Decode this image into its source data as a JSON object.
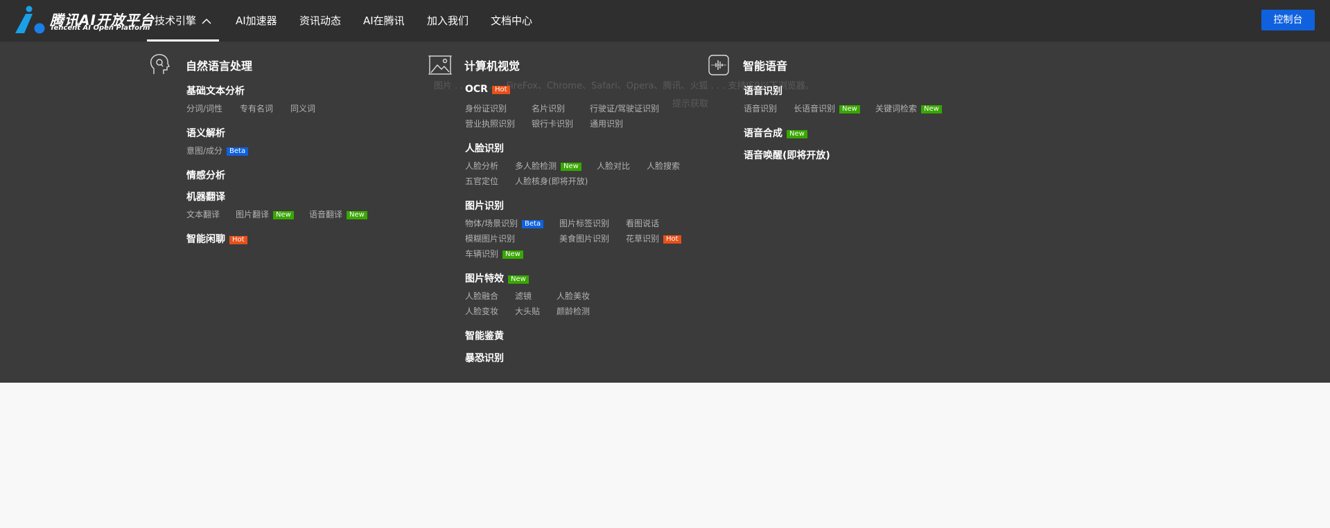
{
  "brand": {
    "name_cn": "腾讯AI开放平台",
    "name_en": "Tencent AI Open Platform"
  },
  "nav": {
    "items": [
      {
        "label": "技术引擎",
        "active": true
      },
      {
        "label": "AI加速器"
      },
      {
        "label": "资讯动态"
      },
      {
        "label": "AI在腾讯"
      },
      {
        "label": "加入我们"
      },
      {
        "label": "文档中心"
      }
    ],
    "console_label": "控制台"
  },
  "background_text": {
    "line1": "图片 . . . . . . . . . FireFox、Chrome、Safari、Opera、腾讯、火狐 . . . 支持IE9以下浏览器。",
    "line2": "提示获取"
  },
  "badges": {
    "hot": "Hot",
    "new": "New",
    "beta": "Beta"
  },
  "columns": {
    "nlp": {
      "title": "自然语言处理",
      "sections": {
        "basic": {
          "title": "基础文本分析",
          "links": [
            "分词/词性",
            "专有名词",
            "同义词"
          ]
        },
        "semantic": {
          "title": "语义解析",
          "links": [
            "意图/成分"
          ]
        },
        "sentiment": {
          "title": "情感分析"
        },
        "translate": {
          "title": "机器翻译",
          "links": [
            "文本翻译",
            "图片翻译",
            "语音翻译"
          ]
        },
        "chat": {
          "title": "智能闲聊"
        }
      }
    },
    "cv": {
      "title": "计算机视觉",
      "sections": {
        "ocr": {
          "title": "OCR",
          "links": [
            "身份证识别",
            "名片识别",
            "行驶证/驾驶证识别",
            "营业执照识别",
            "银行卡识别",
            "通用识别"
          ]
        },
        "face": {
          "title": "人脸识别",
          "links": [
            "人脸分析",
            "多人脸检测",
            "人脸对比",
            "人脸搜索",
            "五官定位",
            "人脸核身(即将开放)"
          ]
        },
        "image": {
          "title": "图片识别",
          "links": [
            "物体/场景识别",
            "图片标签识别",
            "看图说话",
            "模糊图片识别",
            "美食图片识别",
            "花草识别",
            "车辆识别"
          ]
        },
        "effects": {
          "title": "图片特效",
          "links": [
            "人脸融合",
            "滤镜",
            "人脸美妆",
            "人脸变妆",
            "大头贴",
            "颜龄检测"
          ]
        },
        "porn": {
          "title": "智能鉴黄"
        },
        "terror": {
          "title": "暴恐识别"
        }
      }
    },
    "speech": {
      "title": "智能语音",
      "sections": {
        "asr": {
          "title": "语音识别",
          "links": [
            "语音识别",
            "长语音识别",
            "关键词检索"
          ]
        },
        "tts": {
          "title": "语音合成"
        },
        "wake": {
          "title": "语音唤醒(即将开放)"
        }
      }
    }
  },
  "colors": {
    "bar": "#2f2f2f",
    "menu": "#3b3b3b",
    "accent": "#0f61de",
    "hot": "#e8501a",
    "new": "#38a700"
  }
}
